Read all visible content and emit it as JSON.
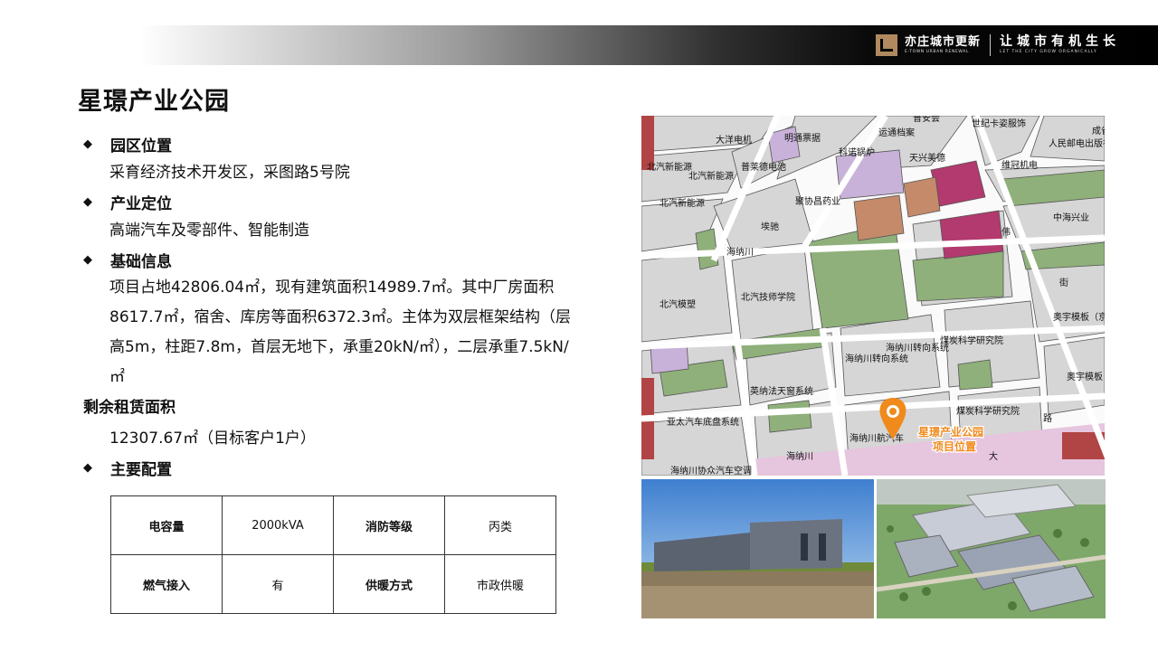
{
  "header": {
    "brand_cn": "亦庄城市更新",
    "brand_en": "E-TOWN URBAN RENEWAL",
    "slogan_cn": "让城市有机生长",
    "slogan_en": "LET THE CITY GROW ORGANICALLY"
  },
  "page_title": "星璟产业公园",
  "sections": {
    "location": {
      "heading": "园区位置",
      "text": "采育经济技术开发区，采图路5号院"
    },
    "positioning": {
      "heading": "产业定位",
      "text": "高端汽车及零部件、智能制造"
    },
    "basic": {
      "heading": "基础信息",
      "text": "项目占地42806.04㎡，现有建筑面积14989.7㎡。其中厂房面积8617.7㎡，宿舍、库房等面积6372.3㎡。主体为双层框架结构（层高5m，柱距7.8m，首层无地下，承重20kN/㎡），二层承重7.5kN/㎡"
    },
    "remaining": {
      "heading": "剩余租赁面积",
      "text": "12307.67㎡（目标客户1户）"
    },
    "config": {
      "heading": "主要配置"
    }
  },
  "config_table": {
    "row1": {
      "l1": "电容量",
      "v1": "2000kVA",
      "l2": "消防等级",
      "v2": "丙类"
    },
    "row2": {
      "l1": "燃气接入",
      "v1": "有",
      "l2": "供暖方式",
      "v2": "市政供暖"
    }
  },
  "map": {
    "marker_line1": "星璟产业公园",
    "marker_line2": "项目位置",
    "labels": [
      "普安会",
      "世纪卡姿服饰",
      "运通档案",
      "大洋电机",
      "明通票据",
      "成省",
      "人民邮电出版社",
      "科诺锅炉",
      "天兴美德",
      "维冠机电",
      "北汽新能源",
      "北汽新能源",
      "普莱德电池",
      "聚协昌药业",
      "北汽新能源",
      "中海兴业",
      "埃驰",
      "海纳川",
      "伟",
      "街",
      "北汽模塑",
      "北汽技师学院",
      "奥宇模板（京东库房）",
      "煤炭科学研究院",
      "海纳川转向系统",
      "海纳川转向系统",
      "奥宇模板（京东库房）",
      "英纳法天窗系统",
      "煤炭科学研究院",
      "亚太汽车底盘系统",
      "海纳川",
      "海纳川航汽车",
      "海纳川协众汽车空调",
      "路",
      "大"
    ]
  },
  "colors": {
    "map_block": "#d6d6d6",
    "map_green": "#8fb07a",
    "map_magenta": "#b23a6e",
    "map_lilac": "#c9b2d9",
    "marker_orange": "#f08a1c",
    "map_red_strip": "#b14444"
  }
}
